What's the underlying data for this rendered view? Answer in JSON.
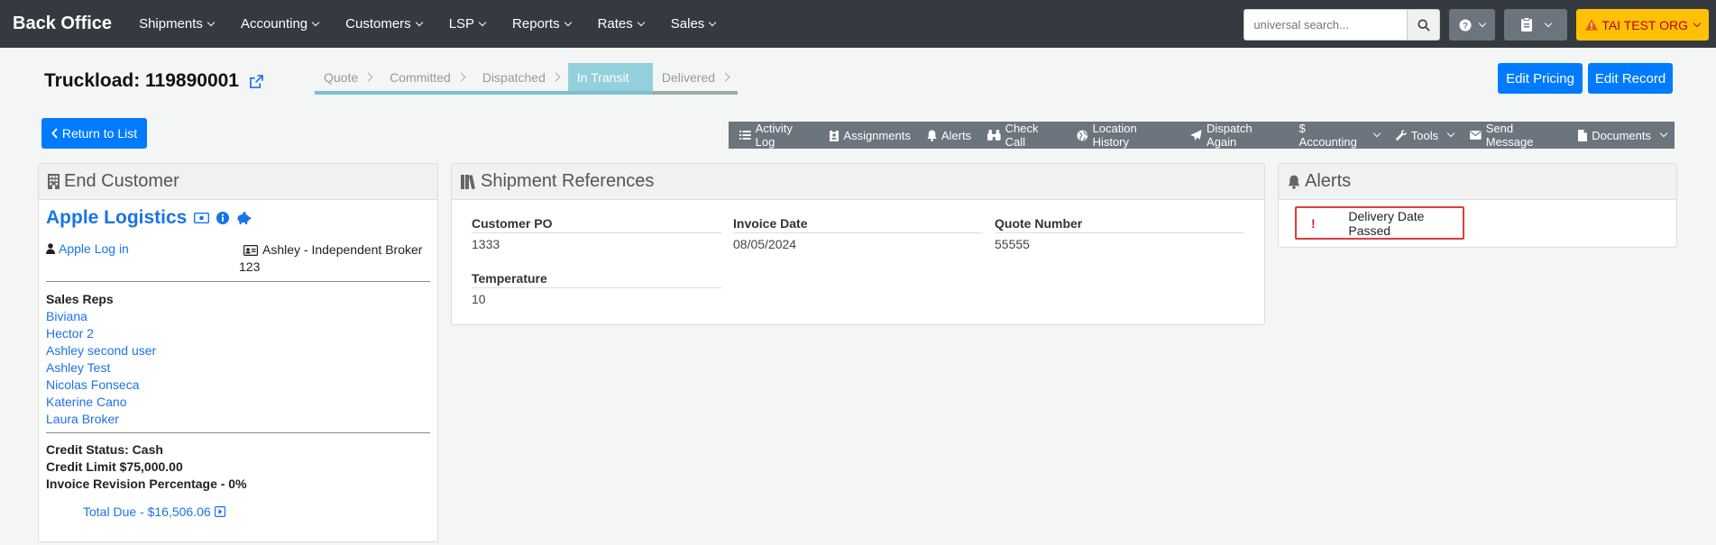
{
  "nav": {
    "brand": "Back Office",
    "items": [
      "Shipments",
      "Accounting",
      "Customers",
      "LSP",
      "Reports",
      "Rates",
      "Sales"
    ],
    "search_placeholder": "universal search...",
    "org_label": "TAI TEST ORG"
  },
  "header": {
    "title": "Truckload: 119890001",
    "steps": [
      "Quote",
      "Committed",
      "Dispatched",
      "In Transit",
      "Delivered"
    ],
    "active_step": "In Transit",
    "edit_pricing": "Edit Pricing",
    "edit_record": "Edit Record"
  },
  "actions": {
    "return_label": "Return to List",
    "toolbar": [
      "Activity Log",
      "Assignments",
      "Alerts",
      "Check Call",
      "Location History",
      "Dispatch Again",
      "$ Accounting",
      "Tools",
      "Send Message",
      "Documents"
    ]
  },
  "end_customer": {
    "heading": "End Customer",
    "name": "Apple Logistics",
    "login_link": "Apple Log in",
    "broker_line1": "Ashley - Independent Broker",
    "broker_line2": "123",
    "sales_reps_label": "Sales Reps",
    "sales_reps": [
      "Biviana",
      "Hector 2",
      "Ashley second user",
      "Ashley Test",
      "Nicolas Fonseca",
      "Katerine Cano",
      "Laura Broker"
    ],
    "credit_status": "Credit Status: Cash",
    "credit_limit": "Credit Limit $75,000.00",
    "invoice_revision": "Invoice Revision Percentage - 0%",
    "total_due": "Total Due - $16,506.06"
  },
  "shipment_refs": {
    "heading": "Shipment References",
    "fields": [
      {
        "label": "Customer PO",
        "value": "1333"
      },
      {
        "label": "Invoice Date",
        "value": "08/05/2024"
      },
      {
        "label": "Quote Number",
        "value": "55555"
      },
      {
        "label": "Temperature",
        "value": "10"
      }
    ]
  },
  "alerts": {
    "heading": "Alerts",
    "items": [
      {
        "mark": "!",
        "text": "Delivery Date Passed"
      }
    ]
  },
  "colors": {
    "navbar": "#343a40",
    "primary": "#007bff",
    "toolbar": "#6c757d",
    "org_button": "#ffc107",
    "step_active": "#94d0dc",
    "alert_border": "#e03c3c"
  }
}
